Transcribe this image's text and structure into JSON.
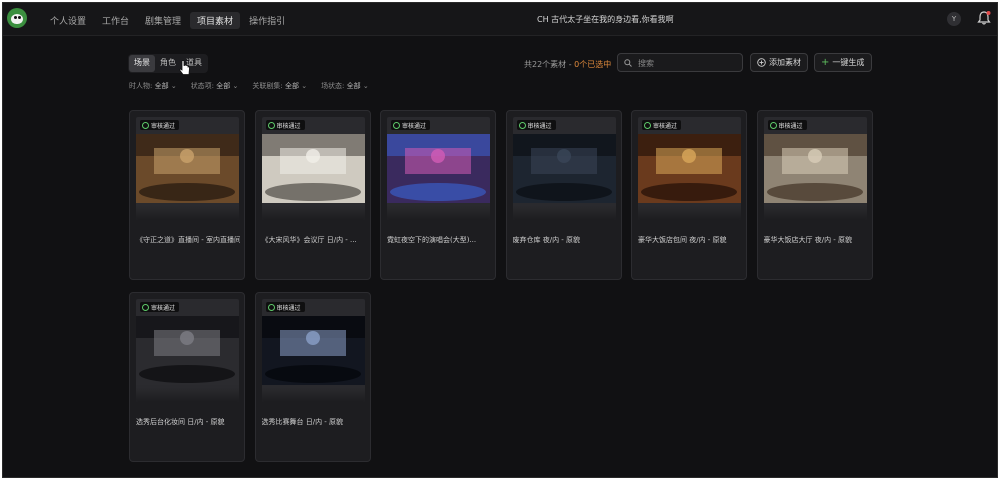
{
  "nav": {
    "items": [
      "个人设置",
      "工作台",
      "剧集管理",
      "项目素材",
      "操作指引"
    ],
    "active_index": 3
  },
  "header": {
    "title": "CH 古代太子坐在我的身边看,你看我啊",
    "avatar_letter": "Y"
  },
  "toolbar": {
    "segments": [
      "场景",
      "角色",
      "道具"
    ],
    "active_segment": 0,
    "count_prefix": "共22个素材 - ",
    "count_selected": "0个已选中",
    "search_placeholder": "搜索",
    "add_button": "添加素材",
    "generate_button": "一键生成"
  },
  "filters": [
    {
      "label": "时人物:",
      "value": "全部"
    },
    {
      "label": "状态项:",
      "value": "全部"
    },
    {
      "label": "关联剧集:",
      "value": "全部"
    },
    {
      "label": "场状态:",
      "value": "全部"
    }
  ],
  "cards": [
    {
      "badge": "审核通过",
      "title": "《守正之道》直播间 - 室内直播间 ...",
      "palette": [
        "#6b4a2a",
        "#c9a36b",
        "#2c1d12"
      ]
    },
    {
      "badge": "审核通过",
      "title": "《大宋风华》会议厅 日/内 - ...",
      "palette": [
        "#cfcac0",
        "#f1efe8",
        "#5e5a54"
      ]
    },
    {
      "badge": "审核通过",
      "title": "霓虹夜空下的演唱会(大型)...",
      "palette": [
        "#3a2a5e",
        "#d25bb5",
        "#3a56b8"
      ]
    },
    {
      "badge": "审核通过",
      "title": "废弃仓库 夜/内 - 原貌",
      "palette": [
        "#1d2530",
        "#3a4658",
        "#0d1016"
      ]
    },
    {
      "badge": "审核通过",
      "title": "豪华大饭店包间 夜/内 - 原貌",
      "palette": [
        "#6a3a1d",
        "#d9a75a",
        "#2a140a"
      ]
    },
    {
      "badge": "审核通过",
      "title": "豪华大饭店大厅 夜/内 - 原貌",
      "palette": [
        "#8f8474",
        "#d8cdb8",
        "#4a3c2e"
      ]
    },
    {
      "badge": "审核通过",
      "title": "选秀后台化妆间 日/内 - 原貌",
      "palette": [
        "#2b2b2f",
        "#7d7d84",
        "#0f0f12"
      ]
    },
    {
      "badge": "审核通过",
      "title": "选秀比赛舞台 日/内 - 原貌",
      "palette": [
        "#121620",
        "#8aa0c8",
        "#05070c"
      ]
    }
  ]
}
